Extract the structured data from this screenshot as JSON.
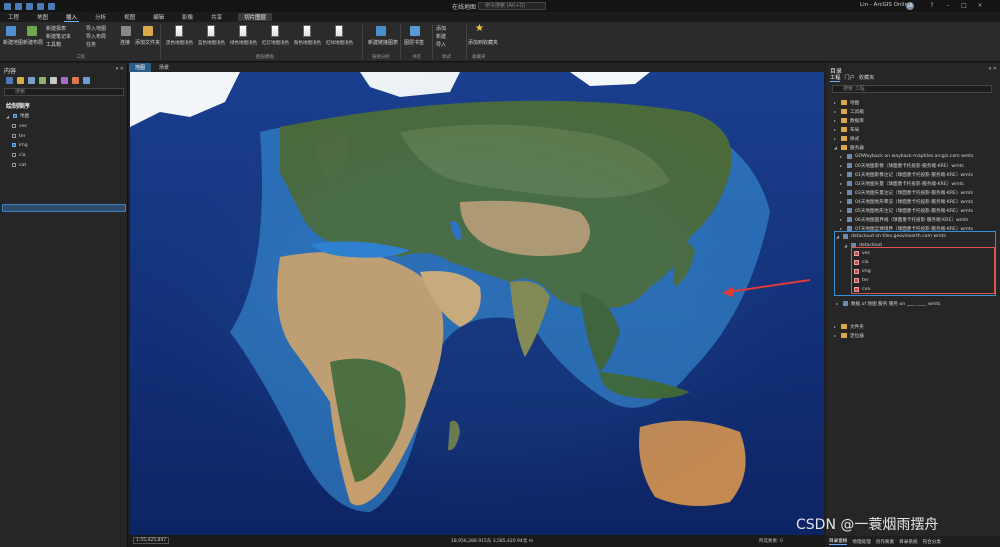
{
  "titlebar": {
    "title": "在线地图",
    "search_placeholder": "命令搜索 (Alt+Q)",
    "user": "Lin - ArcGIS Online",
    "avatar_initials": "LR"
  },
  "ribbon_tabs": [
    "工程",
    "地图",
    "插入",
    "分析",
    "视图",
    "编辑",
    "影像",
    "共享",
    "切片图层"
  ],
  "active_tab": "插入",
  "ribbon": {
    "new_map": "新建地图",
    "new_layout": "新建布局",
    "new_report": "新建报表",
    "new_notebook": "新建笔记本",
    "toolbox": "工具箱",
    "import_map": "导入地图",
    "import_layout": "导入布局",
    "import_other": "任务",
    "connect": "连接",
    "add_folder": "添加文件夹",
    "group_project": "工程",
    "basemaps": [
      "黑色地图浅色",
      "蓝色地图浅色",
      "绿色地图浅色",
      "红灯地图浅色",
      "粉色地图浅色",
      "红绿地图浅色"
    ],
    "group_styles": "图层模板",
    "new_link_chart": "新建链接图表",
    "group_link": "链接分析",
    "new_bookmark": "图层书签",
    "group_book": "书签",
    "add_item": "添加",
    "new_item": "新建",
    "import_item": "导入",
    "group_style": "样式",
    "add_favorite": "添加到收藏夹",
    "group_fav": "收藏夹"
  },
  "left_pane": {
    "title": "内容",
    "filter_placeholder": "搜索",
    "draw_order": "绘制顺序",
    "map_name": "地图",
    "layers": [
      "vec",
      "ter",
      "img",
      "cia",
      "cat"
    ],
    "checked": [
      false,
      false,
      true,
      false,
      false
    ],
    "selected_layer": "img"
  },
  "map_view": {
    "tabs": [
      "地图",
      "场景"
    ],
    "scale": "1:55,425,847",
    "coordinates": "18,956,288.915东  3,585,420.94北 m",
    "selected_features": "所选要素: 0"
  },
  "right_pane": {
    "title": "目录",
    "tabs": [
      "工程",
      "门户",
      "收藏夹"
    ],
    "search_placeholder": "搜索 工程",
    "top_items": [
      "地图",
      "工具箱",
      "数据库",
      "布局",
      "样式",
      "服务器"
    ],
    "servers": [
      "GOWayback on wayback-maptiles.arcgis.com wmts",
      "00天地图影像（球面墨卡托投影-服务端-KRE）wmts",
      "01天地图影像注记（球面墨卡托投影-服务端-KRE）wmts",
      "02天地图矢量（球面墨卡托投影-服务端-KRE）wmts",
      "03天地图矢量注记（球面墨卡托投影-服务端-KRE）wmts",
      "04天地图地形晕渲（球面墨卡托投影-服务端-KRE）wmts",
      "05天地图地形注记（球面墨卡托投影-服务端-KRE）wmts",
      "06天地图国界线（球面墨卡托投影-服务端-KRE）wmts",
      "07天地图全球境界（球面墨卡托投影-服务端-KRE）wmts"
    ],
    "datacloud_server": "datacloud on tiles.geovisearth.com wmts",
    "datacloud_folder": "datacloud",
    "datacloud_layers": [
      "vec",
      "cia",
      "img",
      "ter",
      "cva"
    ],
    "extra_server": "数据 of 地图 服务 服务 on ____  ____ wmts",
    "bottom_items": [
      "文件夹",
      "定位器"
    ],
    "footer_tabs": [
      "目录窗格",
      "地理处理",
      "创作要素",
      "目录系统",
      "符合分类"
    ]
  },
  "watermark": "CSDN @一蓑烟雨摆舟",
  "colors": {
    "accent": "#2d6fb0",
    "highlight_box": "#3a8fd9",
    "annotation": "#d9534f"
  }
}
